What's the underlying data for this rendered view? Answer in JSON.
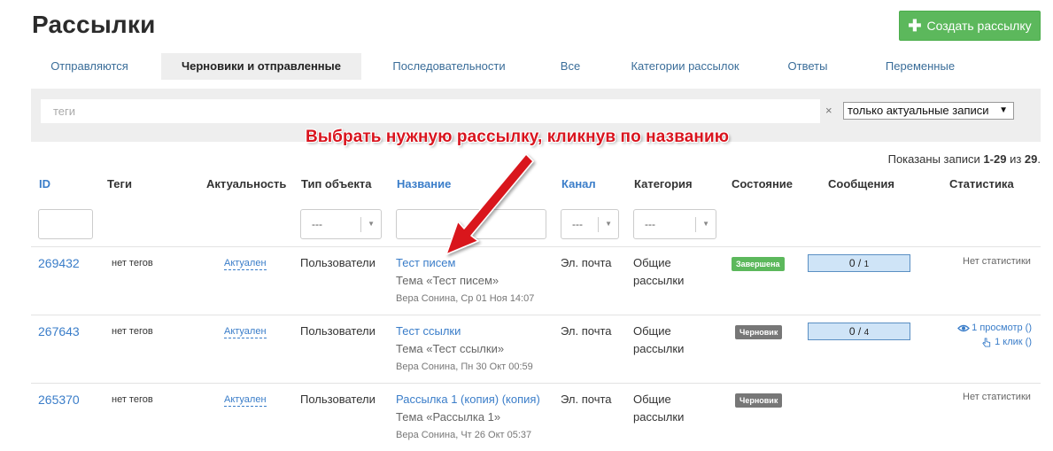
{
  "page": {
    "title": "Рассылки"
  },
  "toolbar": {
    "create_label": "Создать рассылку"
  },
  "tabs": [
    {
      "label": "Отправляются",
      "active": false
    },
    {
      "label": "Черновики и отправленные",
      "active": true
    },
    {
      "label": "Последовательности",
      "active": false
    },
    {
      "label": "Все",
      "active": false
    },
    {
      "label": "Категории рассылок",
      "active": false
    },
    {
      "label": "Ответы",
      "active": false
    },
    {
      "label": "Переменные",
      "active": false
    }
  ],
  "filter": {
    "tags_placeholder": "теги",
    "clear_symbol": "×",
    "actual_select": "только актуальные записи",
    "select_caret": "▼"
  },
  "annotation": {
    "text": "Выбрать нужную рассылку, кликнув по названию"
  },
  "records": {
    "prefix": "Показаны записи ",
    "range": "1-29",
    "middle": " из ",
    "total": "29",
    "suffix": "."
  },
  "columns": {
    "id": "ID",
    "tags": "Теги",
    "actuality": "Актуальность",
    "object_type": "Тип объекта",
    "name": "Название",
    "channel": "Канал",
    "category": "Категория",
    "state": "Состояние",
    "messages": "Сообщения",
    "stats": "Статистика"
  },
  "column_filters": {
    "object_type": "---",
    "channel": "---",
    "category": "---"
  },
  "rows": [
    {
      "id": "269432",
      "tags": "нет тегов",
      "actuality": "Актуален",
      "object_type": "Пользователи",
      "name": "Тест писем",
      "subject": "Тема «Тест писем»",
      "meta": "Вера Сонина, Ср 01 Ноя 14:07",
      "channel": "Эл. почта",
      "category_line1": "Общие",
      "category_line2": "рассылки",
      "state": "Завершена",
      "msg_sent": "0",
      "msg_total": "1",
      "stats": "Нет статистики"
    },
    {
      "id": "267643",
      "tags": "нет тегов",
      "actuality": "Актуален",
      "object_type": "Пользователи",
      "name": "Тест ссылки",
      "subject": "Тема «Тест ссылки»",
      "meta": "Вера Сонина, Пн 30 Окт 00:59",
      "channel": "Эл. почта",
      "category_line1": "Общие",
      "category_line2": "рассылки",
      "state": "Черновик",
      "msg_sent": "0",
      "msg_total": "4",
      "stats_views": "1 просмотр ()",
      "stats_clicks": "1 клик ()"
    },
    {
      "id": "265370",
      "tags": "нет тегов",
      "actuality": "Актуален",
      "object_type": "Пользователи",
      "name": "Рассылка 1 (копия) (копия)",
      "subject": "Тема «Рассылка 1»",
      "meta": "Вера Сонина, Чт 26 Окт 05:37",
      "channel": "Эл. почта",
      "category_line1": "Общие",
      "category_line2": "рассылки",
      "state": "Черновик",
      "stats": "Нет статистики"
    }
  ],
  "colors": {
    "accent": "#3a7dc9",
    "create_button": "#5cb85c",
    "annotation": "#d9141e",
    "draft_badge": "#777777"
  }
}
